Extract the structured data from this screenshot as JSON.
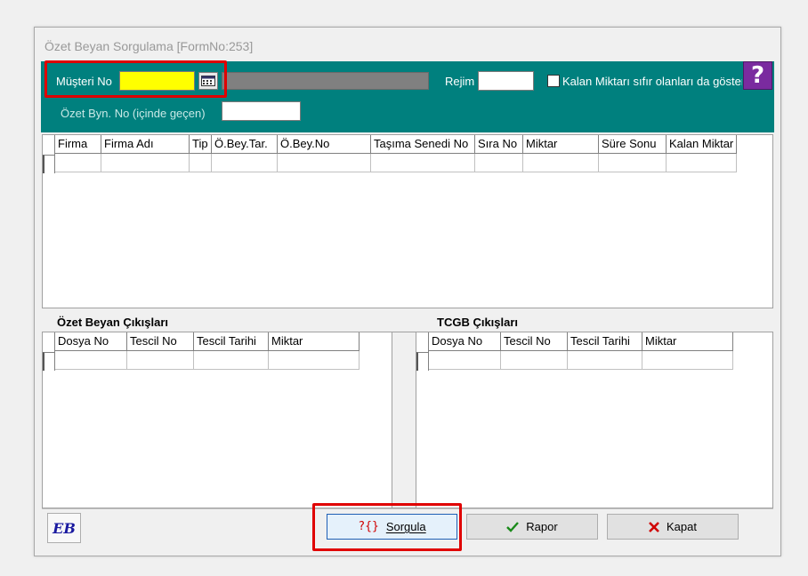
{
  "window": {
    "title": "Özet Beyan Sorgulama [FormNo:253]"
  },
  "filters": {
    "musteri_label": "Müşteri No",
    "musteri_value": "",
    "rejim_label": "Rejim",
    "rejim_value": "",
    "checkbox_label": "Kalan Miktarı sıfır olanları da göster",
    "checkbox_checked": false,
    "ozet_label": "Özet Byn. No (içinde geçen)",
    "ozet_value": "",
    "help_glyph": "?"
  },
  "main_grid": {
    "columns": [
      "Firma",
      "Firma Adı",
      "Tip",
      "Ö.Bey.Tar.",
      "Ö.Bey.No",
      "Taşıma Senedi No",
      "Sıra No",
      "Miktar",
      "Süre Sonu",
      "Kalan Miktar"
    ]
  },
  "ozet_cikislari": {
    "title": "Özet Beyan Çıkışları",
    "columns": [
      "Dosya No",
      "Tescil No",
      "Tescil Tarihi",
      "Miktar"
    ]
  },
  "tcgb_cikislari": {
    "title": "TCGB Çıkışları",
    "columns": [
      "Dosya No",
      "Tescil No",
      "Tescil Tarihi",
      "Miktar"
    ]
  },
  "buttons": {
    "logo_text": "EB",
    "sorgula": "Sorgula",
    "sorgula_icon": "?{}",
    "rapor": "Rapor",
    "kapat": "Kapat"
  },
  "colors": {
    "header_bg": "#00807e",
    "highlight": "#ffff00",
    "annotation": "#e00000"
  }
}
